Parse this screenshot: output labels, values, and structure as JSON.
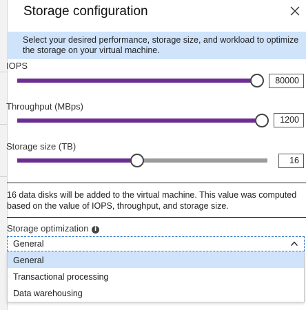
{
  "panel": {
    "title": "Storage configuration",
    "info_text_line1": "Select your desired performance, storage size, and workload to optimize",
    "info_text_line2": "the storage on your virtual machine."
  },
  "sliders": [
    {
      "label": "IOPS",
      "value": "80000",
      "level": 1.0
    },
    {
      "label": "Throughput (MBps)",
      "value": "1200",
      "level": 1.0
    },
    {
      "label": "Storage size (TB)",
      "value": "16",
      "level": 0.48
    }
  ],
  "note": {
    "line1": "16 data disks will be added to the virtual machine. This value was computed",
    "line2": "based on the value of IOPS, throughput, and storage size."
  },
  "optimization": {
    "label": "Storage optimization",
    "info_icon": "i",
    "selected": "General",
    "options": [
      "General",
      "Transactional processing",
      "Data warehousing"
    ]
  },
  "colors": {
    "accent": "#6b2d8f",
    "info_banner": "#cfe3fb",
    "focus_border": "#2b73c9"
  },
  "icons": {
    "close": "close-icon",
    "chevron": "chevron-up-icon",
    "info": "info-icon"
  }
}
